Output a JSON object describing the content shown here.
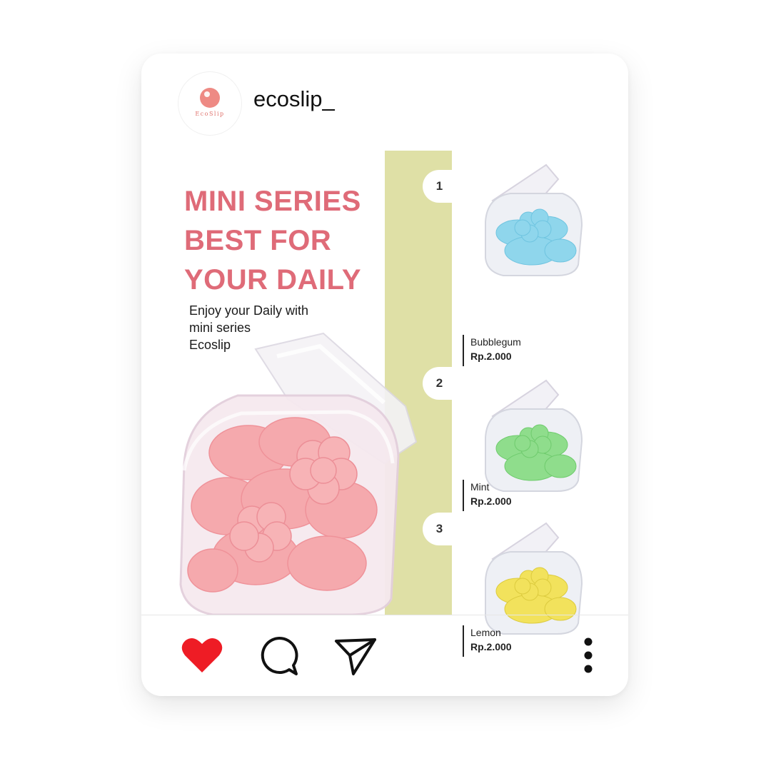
{
  "account": {
    "username": "ecoslip_",
    "logo_text": "EcoSlip"
  },
  "post": {
    "headline": [
      "MINI SERIES",
      "BEST FOR",
      "YOUR DAILY"
    ],
    "subtitle": [
      "Enjoy your Daily with",
      "mini series",
      "Ecoslip"
    ],
    "colors": {
      "headline": "#df6b78",
      "strip": "#dfe0a6",
      "hero": "#f5a9ad"
    },
    "products": [
      {
        "number": "1",
        "name": "Bubblegum",
        "price": "Rp.2.000",
        "color": "#8fd6ec"
      },
      {
        "number": "2",
        "name": "Mint",
        "price": "Rp.2.000",
        "color": "#8fdd8c"
      },
      {
        "number": "3",
        "name": "Lemon",
        "price": "Rp.2.000",
        "color": "#f2e25c"
      }
    ]
  },
  "actions": {
    "like_icon": "heart-icon",
    "comment_icon": "comment-icon",
    "share_icon": "send-icon",
    "more_icon": "more-vertical-icon",
    "like_color": "#ee1c25"
  }
}
